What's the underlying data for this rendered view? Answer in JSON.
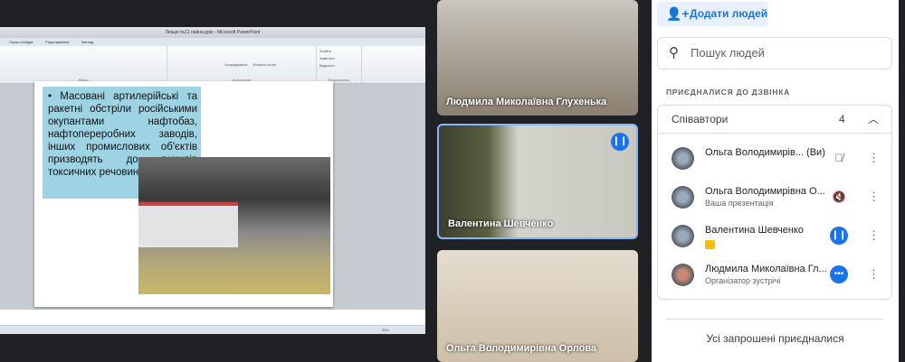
{
  "powerpoint": {
    "title": "Лекція №11 пайна.pptx - Microsoft PowerPoint",
    "menu": [
      "Показ слайдів",
      "Рецензування",
      "Вигляд"
    ],
    "groups": [
      "Абзац",
      "Креслення",
      "Редагування"
    ],
    "ribbon_buttons": [
      "Упорядкувати",
      "Експрес-стилі",
      "Знайти",
      "Замінити",
      "Виділити"
    ],
    "zoom": "55%"
  },
  "slide": {
    "bullet": "Масовані артилерійські та ракетні обстріли російськими окупантами нафтобаз, нафтопереробних заводів, інших промислових об'єктів призводять до викидів токсичних речовин у повітря."
  },
  "tiles": [
    {
      "name": "Людмила Миколаївна Глухенька"
    },
    {
      "name": "Валентина Шевченко"
    },
    {
      "name": "Ольга Володимирівна Орлова"
    }
  ],
  "panel": {
    "add_people": "Додати людей",
    "search_placeholder": "Пошук людей",
    "section": "ПРИЄДНАЛИСЯ ДО ДЗВІНКА",
    "group": "Співавтори",
    "count": "4",
    "people": [
      {
        "name": "Ольга Володимирів...  (Ви)",
        "sub": ""
      },
      {
        "name": "Ольга Володимирівна О...",
        "sub": "Ваша презентація"
      },
      {
        "name": "Валентина Шевченко",
        "sub": ""
      },
      {
        "name": "Людмила Миколаївна Гл...",
        "sub": "Організатор зустрічі"
      }
    ],
    "footer": "Усі запрошені приєдналися"
  }
}
